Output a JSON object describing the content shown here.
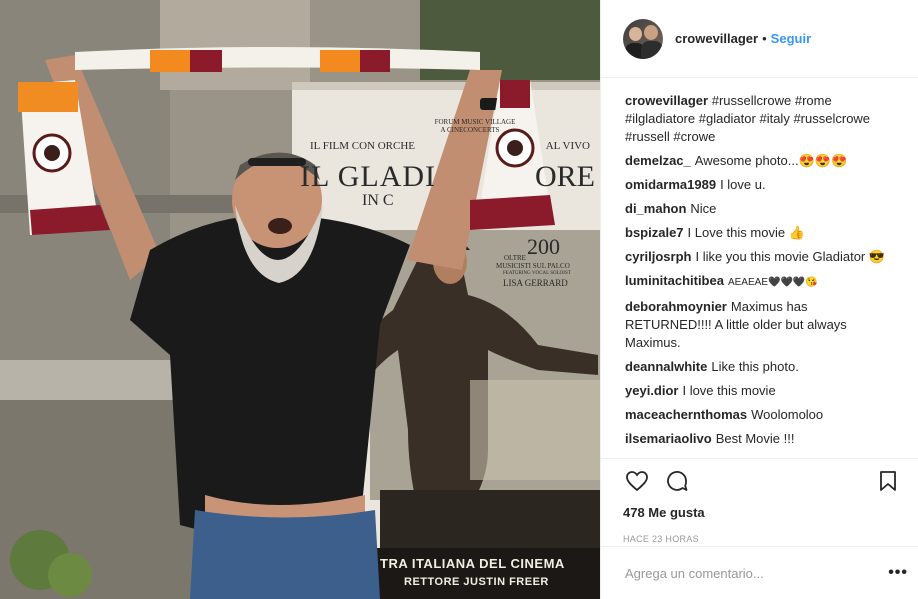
{
  "post": {
    "username": "crowevillager",
    "follow_label": "Seguir",
    "separator": "•",
    "caption_tags": [
      "#russellcrowe",
      "#rome",
      "#ilgladiatore",
      "#gladiator",
      "#italy",
      "#russelcrowe",
      "#russell",
      "#crowe"
    ],
    "likes": "478 Me gusta",
    "time": "HACE 23 HORAS",
    "comment_placeholder": "Agrega un comentario...",
    "more_label": "•••"
  },
  "poster": {
    "line1": "FORUM MUSIC VILLAGE",
    "line2": "A CINECONCERTS",
    "line3": "IL FILM CON ORCHE",
    "line3b": "AL VIVO",
    "title": "IL GLADI",
    "title_end": "ORE",
    "subtitle": "IN C",
    "number": "200",
    "oltre": "OLTRE",
    "musicisti": "MUSICISTI SUL PALCO",
    "featuring": "FEATURING VOCAL SOLOIST",
    "soloist": "LISA GERRARD",
    "bottom1": "TRA ITALIANA DEL CINEMA",
    "bottom2": "RETTORE JUSTIN FREER"
  },
  "comments": [
    {
      "user": "demelzac_",
      "text": "Awesome photo...😍😍😍"
    },
    {
      "user": "omidarma1989",
      "text": "I love u."
    },
    {
      "user": "di_mahon",
      "text": "Nice"
    },
    {
      "user": "bspizale7",
      "text": "I Love this movie 👍"
    },
    {
      "user": "cyriljosrph",
      "text": "I like you this movie Gladiator 😎"
    },
    {
      "user": "luminitachitibea",
      "text": "AEAEAE🖤🖤🖤😘"
    },
    {
      "user": "deborahmoynier",
      "text": "Maximus has RETURNED!!!! A little older but always Maximus."
    },
    {
      "user": "deannalwhite",
      "text": "Like this photo."
    },
    {
      "user": "yeyi.dior",
      "text": "I love this movie"
    },
    {
      "user": "maceachernthomas",
      "text": "Woolomoloo"
    },
    {
      "user": "ilsemariaolivo",
      "text": "Best Movie !!!"
    }
  ],
  "icons": {
    "like": "heart-icon",
    "comment": "comment-icon",
    "save": "bookmark-icon"
  }
}
